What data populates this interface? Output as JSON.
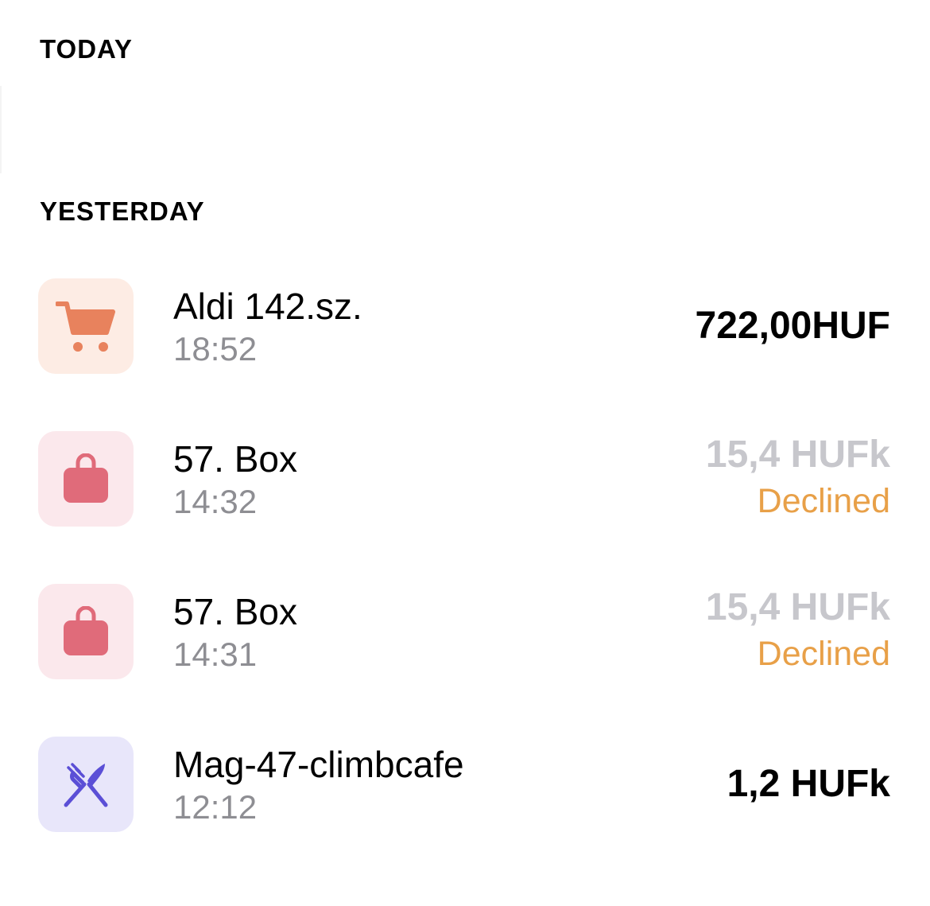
{
  "sections": {
    "today": "TODAY",
    "yesterday": "YESTERDAY"
  },
  "colors": {
    "grocery_icon": "#e8825d",
    "grocery_tile": "#fdece4",
    "shopping_icon": "#e06b7a",
    "shopping_tile": "#fbe8ec",
    "food_icon": "#5b4fd6",
    "food_tile": "#e8e6fa",
    "declined": "#e8a048",
    "muted_amount": "#c7c7cc",
    "time_gray": "#8e8e93"
  },
  "transactions": [
    {
      "icon": "shopping-cart-icon",
      "name": "Aldi 142.sz.",
      "time": "18:52",
      "amount": "722,00HUF",
      "status": ""
    },
    {
      "icon": "shopping-bag-icon",
      "name": "57. Box",
      "time": "14:32",
      "amount": "15,4 HUFk",
      "status": "Declined"
    },
    {
      "icon": "shopping-bag-icon",
      "name": "57. Box",
      "time": "14:31",
      "amount": "15,4 HUFk",
      "status": "Declined"
    },
    {
      "icon": "fork-knife-icon",
      "name": "Mag-47-climbcafe",
      "time": "12:12",
      "amount": "1,2 HUFk",
      "status": ""
    }
  ]
}
